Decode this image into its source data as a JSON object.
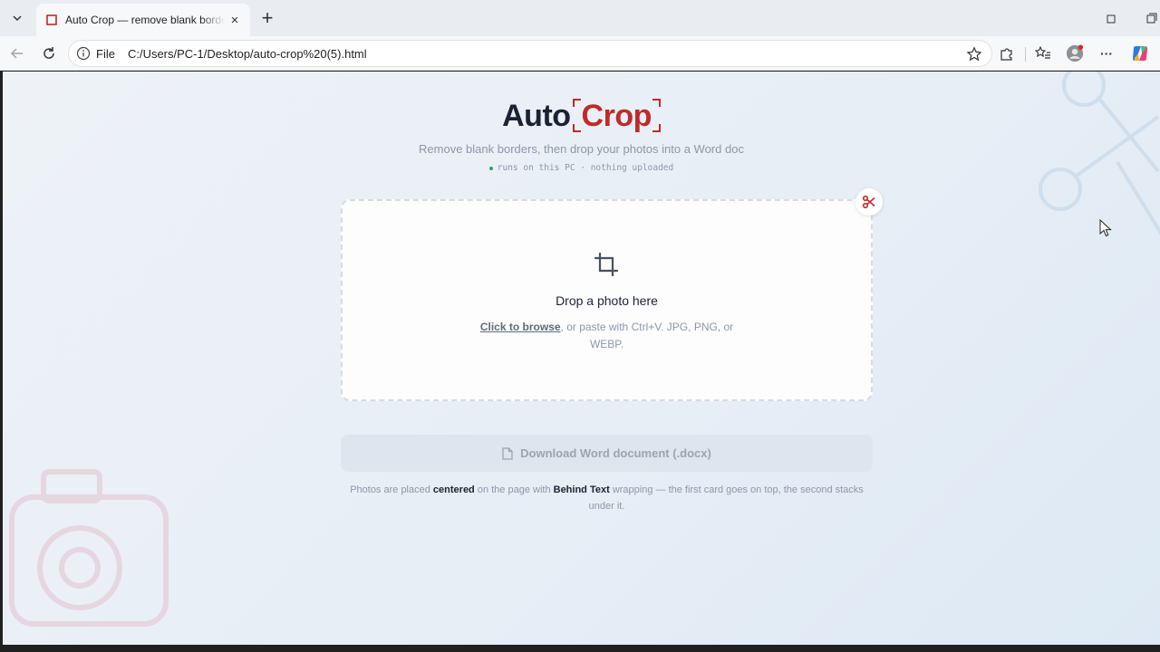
{
  "browser": {
    "tab_title": "Auto Crop — remove blank borders",
    "tab_close": "×",
    "new_tab": "+",
    "address_scheme": "File",
    "address_url": "C:/Users/PC-1/Desktop/auto-crop%20(5).html",
    "more_menu": "···"
  },
  "app": {
    "logo_part1": "Auto",
    "logo_part2": "Crop",
    "subtitle": "Remove blank borders, then drop your photos into a Word doc",
    "local_note": "runs on this PC · nothing uploaded"
  },
  "dropzone": {
    "title": "Drop a photo here",
    "browse_link": "Click to browse",
    "hint_rest": ", or paste with Ctrl+V. JPG, PNG, or WEBP."
  },
  "download": {
    "label": "Download Word document (.docx)"
  },
  "info": {
    "t1": "Photos are placed ",
    "b1": "centered",
    "t2": " on the page with ",
    "b2": "Behind Text",
    "t3": " wrapping — the first card goes on top, the second stacks under it."
  },
  "colors": {
    "accent_red": "#c02a2a",
    "text_dark": "#1c2233",
    "text_muted": "#8d97a8"
  }
}
